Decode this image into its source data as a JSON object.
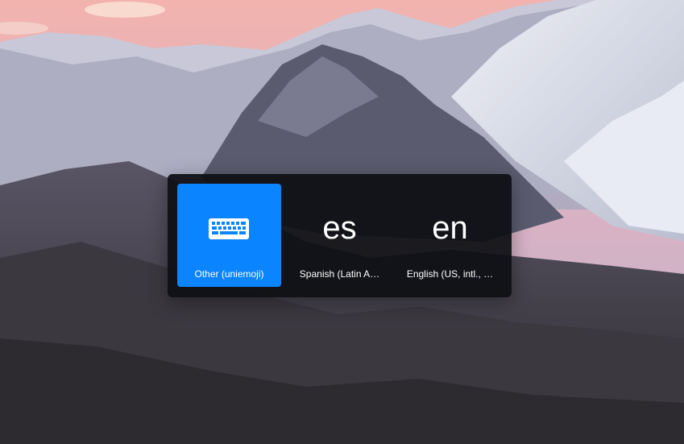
{
  "input_source_switcher": {
    "items": [
      {
        "icon": "keyboard-icon",
        "label": "Other (uniemoji)",
        "selected": true
      },
      {
        "code": "es",
        "label": "Spanish (Latin A…",
        "selected": false
      },
      {
        "code": "en",
        "label": "English (US, intl., …",
        "selected": false
      }
    ],
    "colors": {
      "panel": "#0e1014",
      "selected": "#0a84ff",
      "text": "#ffffff"
    }
  }
}
